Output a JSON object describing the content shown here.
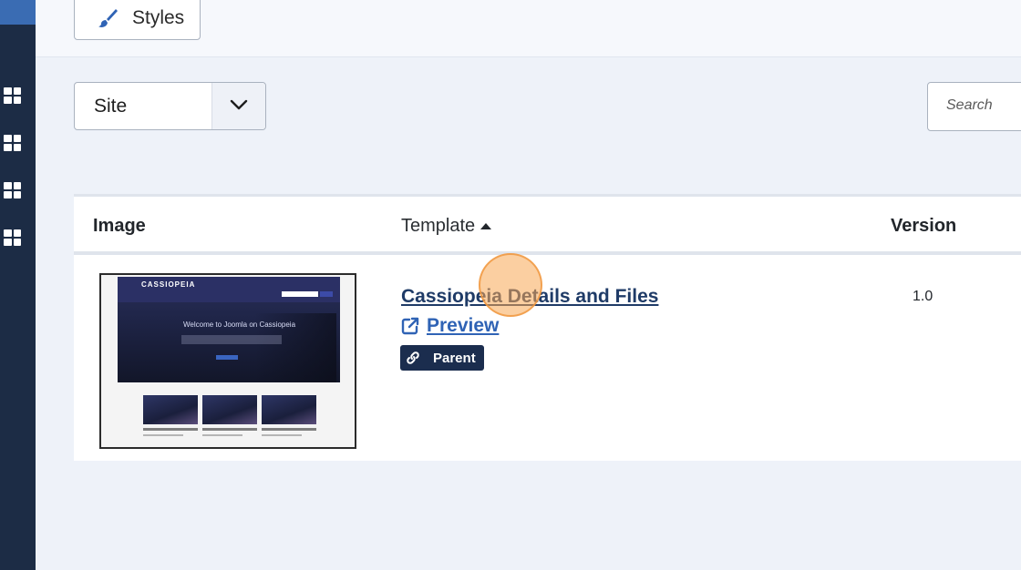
{
  "toolbar": {
    "styles_label": "Styles",
    "styles_icon": "brush-icon"
  },
  "filter": {
    "client_select_value": "Site"
  },
  "search": {
    "placeholder": "Search"
  },
  "table": {
    "columns": {
      "image": "Image",
      "template": "Template",
      "version": "Version"
    },
    "sort": {
      "column": "Template",
      "direction": "ascending"
    },
    "rows": [
      {
        "thumbnail": {
          "brand": "CASSIOPEIA",
          "hero_title": "Welcome to Joomla on Cassiopeia"
        },
        "template_link": "Cassiopeia Details and Files",
        "preview_label": "Preview",
        "badge_label": "Parent",
        "version": "1.0"
      }
    ]
  },
  "colors": {
    "sidebar": "#1c2c45",
    "accent": "#3a6cb3",
    "badge_bg": "#1b2d4e",
    "link": "#1f3b67",
    "preview_link": "#2f63b5",
    "cursor_highlight": "#f8a854"
  }
}
